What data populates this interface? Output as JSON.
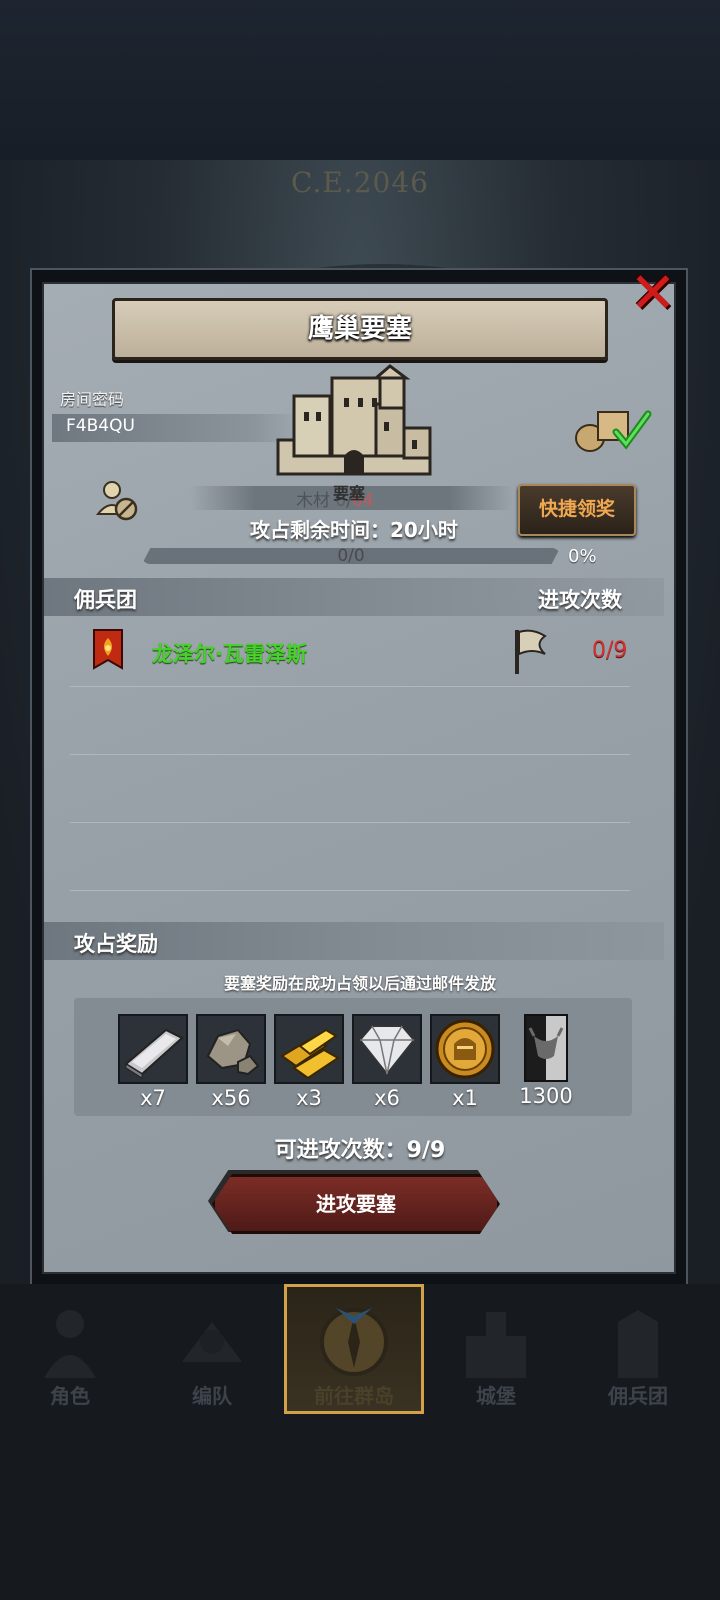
{
  "background": {
    "era": "C.E.2046"
  },
  "dialog": {
    "title": "鹰巢要塞",
    "room_label": "房间密码",
    "room_code": "F4B4QU",
    "resource": {
      "name": "木材",
      "current": "0",
      "max": "64"
    },
    "fortress_tag": "要塞",
    "claim_button": "快捷领奖",
    "time_left": "攻占剩余时间：20小时",
    "progress": {
      "text": "0/0",
      "percent_text": "0%",
      "fraction": 0
    },
    "mercenary_header": "佣兵团",
    "attack_count_header": "进攻次数",
    "mercenaries": [
      {
        "name": "龙泽尔·瓦雷泽斯",
        "count": "0/9"
      }
    ],
    "rewards_header": "攻占奖励",
    "rewards_note": "要塞奖励在成功占领以后通过邮件发放",
    "rewards": [
      {
        "icon": "silver-ingot-icon",
        "qty": "x7"
      },
      {
        "icon": "stone-icon",
        "qty": "x56"
      },
      {
        "icon": "gold-bars-icon",
        "qty": "x3"
      },
      {
        "icon": "diamond-icon",
        "qty": "x6"
      },
      {
        "icon": "knight-medal-icon",
        "qty": "x1"
      },
      {
        "icon": "honor-card-icon",
        "qty": "1300"
      }
    ],
    "attempts_left": "可进攻次数：9/9",
    "attack_button": "进攻要塞"
  },
  "nav": [
    {
      "label": "角色",
      "icon": "knight-icon",
      "active": false
    },
    {
      "label": "编队",
      "icon": "formation-icon",
      "active": false
    },
    {
      "label": "前往群岛",
      "icon": "compass-icon",
      "active": true
    },
    {
      "label": "城堡",
      "icon": "castle-icon",
      "active": false
    },
    {
      "label": "佣兵团",
      "icon": "mercenary-icon",
      "active": false
    }
  ],
  "colors": {
    "accent": "#d1a24a",
    "merc_name": "#48d12c",
    "count": "#cf3232",
    "claim": "#f0a850"
  }
}
